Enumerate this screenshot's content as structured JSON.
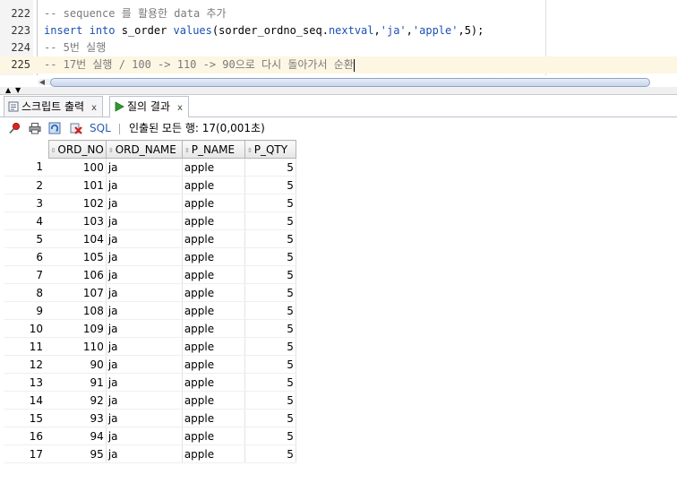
{
  "editor": {
    "lines": [
      {
        "num": "222",
        "tokens": [
          {
            "t": "-- sequence 를 활용한 data 추가",
            "c": "cm"
          }
        ]
      },
      {
        "num": "223",
        "tokens": [
          {
            "t": "insert",
            "c": "kw"
          },
          {
            "t": " ",
            "c": ""
          },
          {
            "t": "into",
            "c": "kw"
          },
          {
            "t": " s_order ",
            "c": ""
          },
          {
            "t": "values",
            "c": "kw"
          },
          {
            "t": "(sorder_ordno_seq.",
            "c": ""
          },
          {
            "t": "nextval",
            "c": "kw"
          },
          {
            "t": ",",
            "c": ""
          },
          {
            "t": "'ja'",
            "c": "str"
          },
          {
            "t": ",",
            "c": ""
          },
          {
            "t": "'apple'",
            "c": "str"
          },
          {
            "t": ",5);",
            "c": ""
          }
        ]
      },
      {
        "num": "224",
        "tokens": [
          {
            "t": "-- 5번 실행",
            "c": "cm"
          }
        ]
      },
      {
        "num": "225",
        "tokens": [
          {
            "t": "-- 17번 실행 / 100 -> 110 -> 90으로 다시 돌아가서 순환",
            "c": "cm"
          }
        ]
      }
    ]
  },
  "tabs": [
    {
      "label": "스크립트 출력",
      "close": "x",
      "icon": "script-output-icon"
    },
    {
      "label": "질의 결과",
      "close": "x",
      "icon": "run-query-icon"
    }
  ],
  "toolbar": {
    "sql_label": "SQL",
    "status": "인출된 모든 행: 17(0,001초)"
  },
  "grid": {
    "columns": [
      "ORD_NO",
      "ORD_NAME",
      "P_NAME",
      "P_QTY"
    ],
    "rows": [
      [
        "1",
        "100",
        "ja",
        "apple",
        "5"
      ],
      [
        "2",
        "101",
        "ja",
        "apple",
        "5"
      ],
      [
        "3",
        "102",
        "ja",
        "apple",
        "5"
      ],
      [
        "4",
        "103",
        "ja",
        "apple",
        "5"
      ],
      [
        "5",
        "104",
        "ja",
        "apple",
        "5"
      ],
      [
        "6",
        "105",
        "ja",
        "apple",
        "5"
      ],
      [
        "7",
        "106",
        "ja",
        "apple",
        "5"
      ],
      [
        "8",
        "107",
        "ja",
        "apple",
        "5"
      ],
      [
        "9",
        "108",
        "ja",
        "apple",
        "5"
      ],
      [
        "10",
        "109",
        "ja",
        "apple",
        "5"
      ],
      [
        "11",
        "110",
        "ja",
        "apple",
        "5"
      ],
      [
        "12",
        "90",
        "ja",
        "apple",
        "5"
      ],
      [
        "13",
        "91",
        "ja",
        "apple",
        "5"
      ],
      [
        "14",
        "92",
        "ja",
        "apple",
        "5"
      ],
      [
        "15",
        "93",
        "ja",
        "apple",
        "5"
      ],
      [
        "16",
        "94",
        "ja",
        "apple",
        "5"
      ],
      [
        "17",
        "95",
        "ja",
        "apple",
        "5"
      ]
    ]
  },
  "colors": {
    "keyword": "#1b4fb6",
    "comment": "#7a7a7a",
    "current_line": "#fdf6e3",
    "sql_link": "#2a5db0"
  }
}
